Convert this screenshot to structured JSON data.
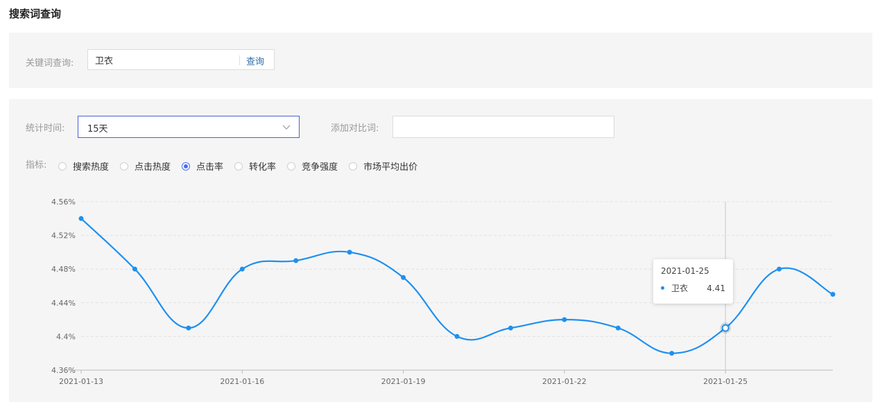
{
  "page_title": "搜索词查询",
  "search": {
    "label": "关键词查询:",
    "value": "卫衣",
    "button": "查询"
  },
  "filters": {
    "period_label": "统计时间:",
    "period_value": "15天",
    "compare_label": "添加对比词:",
    "compare_value": ""
  },
  "metrics": {
    "label": "指标:",
    "options": [
      "搜索热度",
      "点击热度",
      "点击率",
      "转化率",
      "竞争强度",
      "市场平均出价"
    ],
    "selected": "点击率"
  },
  "chart_data": {
    "type": "line",
    "x": [
      "2021-01-13",
      "2021-01-14",
      "2021-01-15",
      "2021-01-16",
      "2021-01-17",
      "2021-01-18",
      "2021-01-19",
      "2021-01-20",
      "2021-01-21",
      "2021-01-22",
      "2021-01-23",
      "2021-01-24",
      "2021-01-25",
      "2021-01-26",
      "2021-01-27"
    ],
    "x_tick_labels": [
      "2021-01-13",
      "2021-01-16",
      "2021-01-19",
      "2021-01-22",
      "2021-01-25"
    ],
    "series": [
      {
        "name": "卫衣",
        "values": [
          4.54,
          4.48,
          4.41,
          4.48,
          4.49,
          4.5,
          4.47,
          4.4,
          4.41,
          4.42,
          4.41,
          4.38,
          4.41,
          4.48,
          4.45
        ]
      }
    ],
    "y_ticks": [
      "4.36%",
      "4.4%",
      "4.44%",
      "4.48%",
      "4.52%",
      "4.56%"
    ],
    "ylim": [
      4.36,
      4.56
    ],
    "grid": true,
    "color": "#1e90f0",
    "highlight_index": 12
  },
  "tooltip": {
    "date": "2021-01-25",
    "series": "卫衣",
    "value": "4.41"
  }
}
